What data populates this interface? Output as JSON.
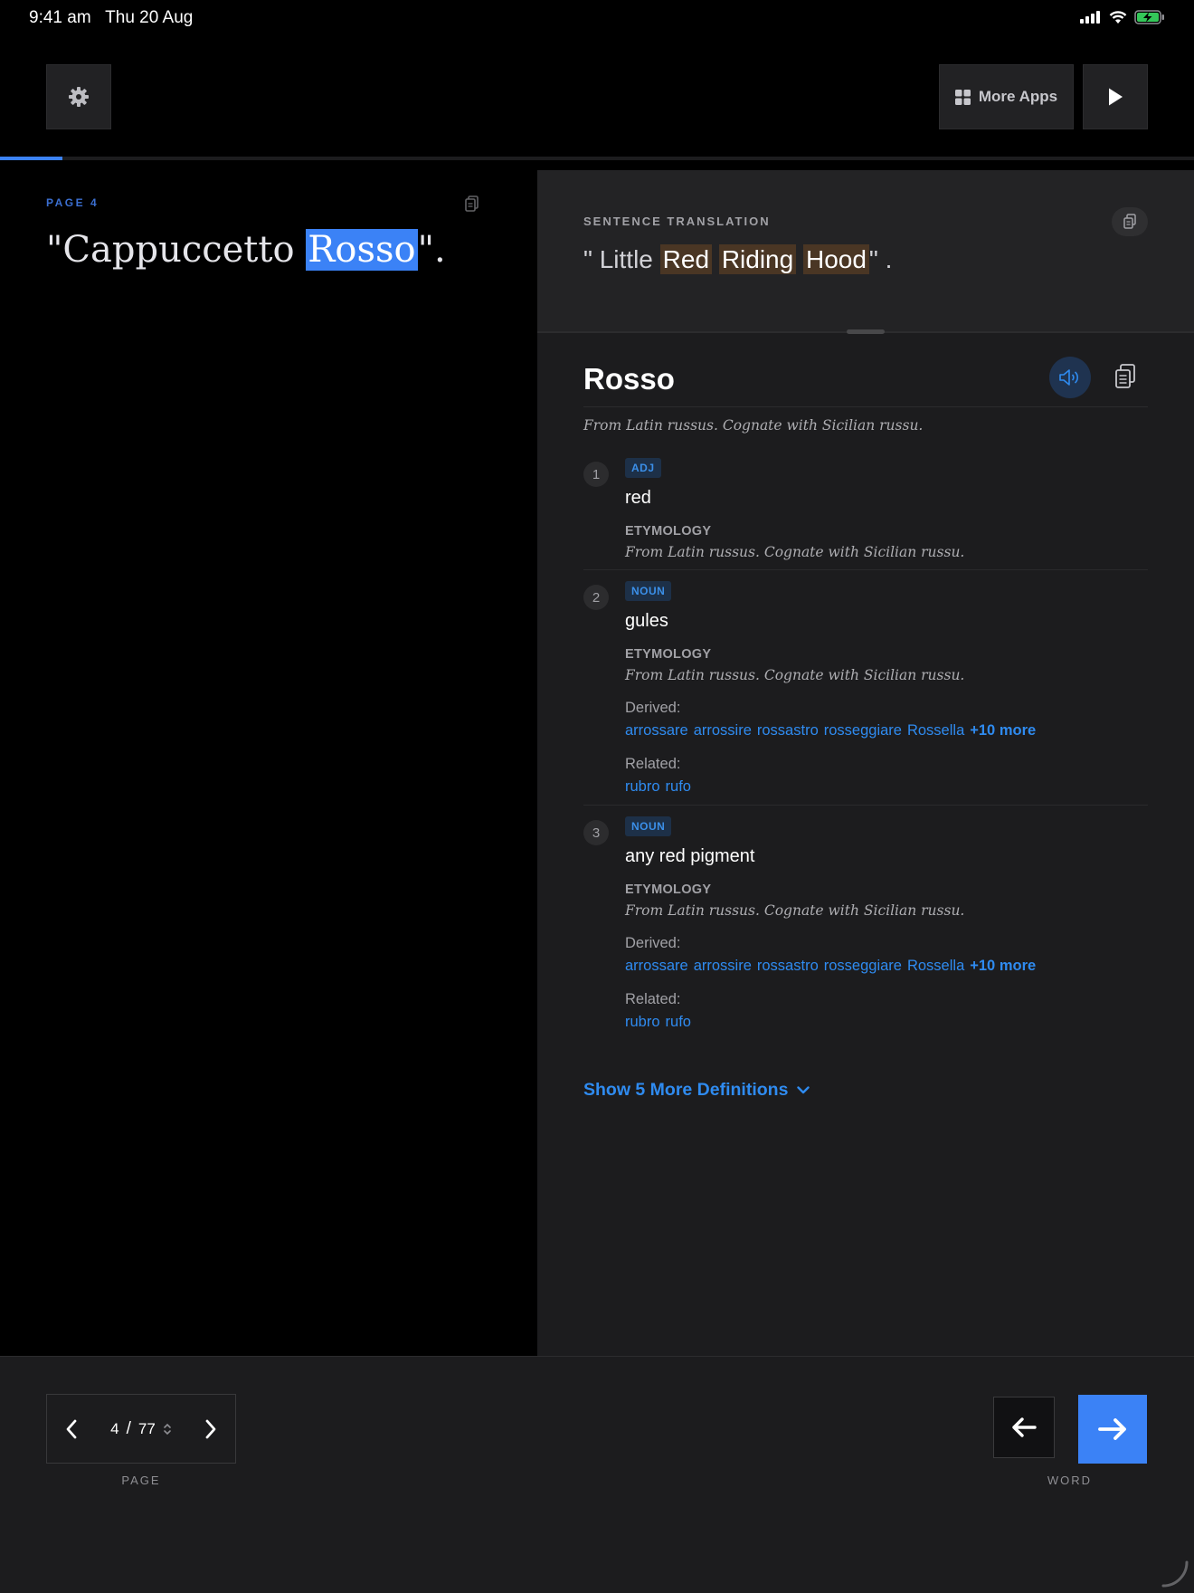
{
  "status_bar": {
    "time": "9:41 am",
    "date": "Thu 20 Aug"
  },
  "toolbar": {
    "settings_icon": "gear-icon",
    "more_apps_label": "More Apps",
    "play_icon": "play-icon"
  },
  "progress": {
    "fraction": 0.052
  },
  "reader": {
    "page_label": "PAGE 4",
    "sentence_before": "\"Cappuccetto ",
    "sentence_highlight": "Rosso",
    "sentence_after": "\"."
  },
  "translation": {
    "label": "SENTENCE TRANSLATION",
    "open_quote": "\" ",
    "word_little": "Little",
    "word_red": "Red",
    "word_riding": "Riding",
    "word_hood": "Hood",
    "close_quote": "\" ."
  },
  "word": {
    "title": "Rosso",
    "etymology": "From Latin russus. Cognate with Sicilian russu.",
    "definitions": [
      {
        "num": "1",
        "pos": "ADJ",
        "meaning": "red",
        "etym_head": "ETYMOLOGY",
        "etym": "From Latin russus. Cognate with Sicilian russu."
      },
      {
        "num": "2",
        "pos": "NOUN",
        "meaning": "gules",
        "etym_head": "ETYMOLOGY",
        "etym": "From Latin russus. Cognate with Sicilian russu.",
        "derived_head": "Derived:",
        "derived": [
          "arrossare",
          "arrossire",
          "rossastro",
          "rosseggiare",
          "Rossella"
        ],
        "derived_more": "+10 more",
        "related_head": "Related:",
        "related": [
          "rubro",
          "rufo"
        ]
      },
      {
        "num": "3",
        "pos": "NOUN",
        "meaning": "any red pigment",
        "etym_head": "ETYMOLOGY",
        "etym": "From Latin russus. Cognate with Sicilian russu.",
        "derived_head": "Derived:",
        "derived": [
          "arrossare",
          "arrossire",
          "rossastro",
          "rosseggiare",
          "Rossella"
        ],
        "derived_more": "+10 more",
        "related_head": "Related:",
        "related": [
          "rubro",
          "rufo"
        ]
      }
    ],
    "show_more": "Show 5 More Definitions"
  },
  "pager": {
    "current": "4",
    "separator": "/",
    "total": "77",
    "caption": "PAGE"
  },
  "word_nav": {
    "caption": "WORD"
  },
  "colors": {
    "accent": "#3b82f6",
    "link": "#2f8bf0",
    "highlight_translation": "#4a3624"
  }
}
